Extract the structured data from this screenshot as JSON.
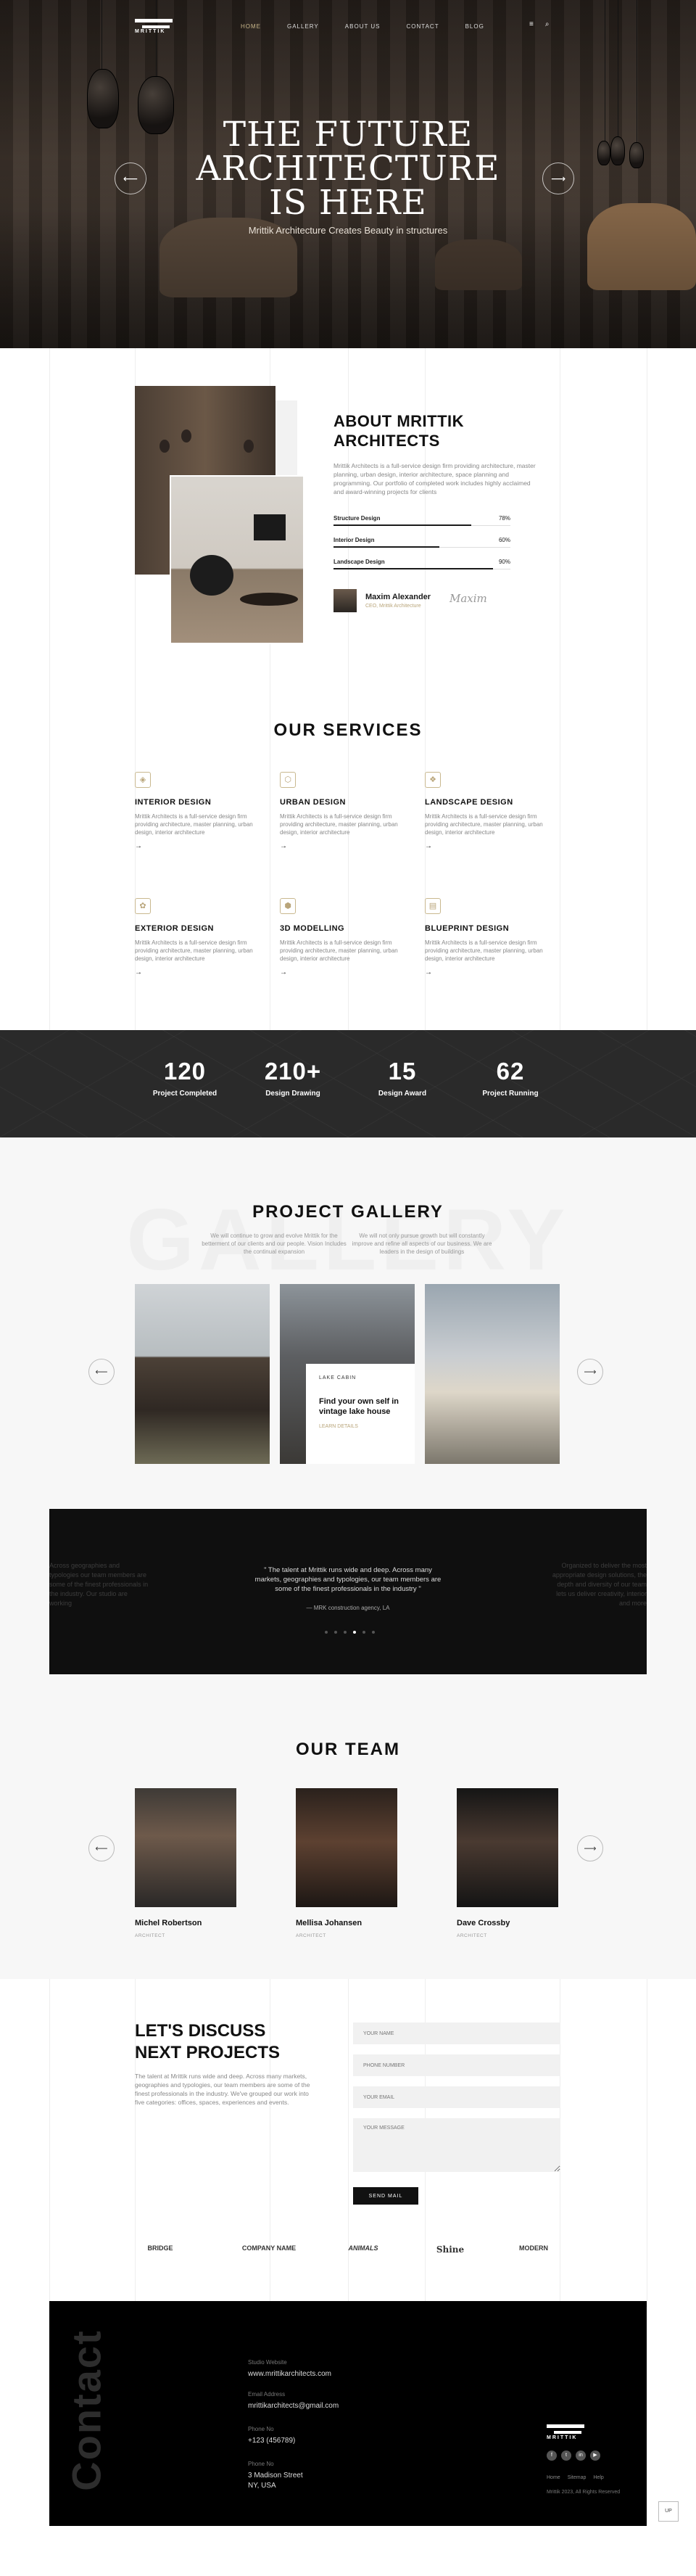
{
  "nav": {
    "logo_text": "MRITTIK",
    "items": [
      "HOME",
      "GALLERY",
      "ABOUT US",
      "CONTACT",
      "BLOG"
    ],
    "active_index": 0
  },
  "hero": {
    "title_lines": [
      "THE FUTURE",
      "ARCHITECTURE",
      "IS HERE"
    ],
    "subtitle": "Mrittik Architecture Creates Beauty in structures",
    "prev_icon": "arrow-left-icon",
    "next_icon": "arrow-right-icon"
  },
  "about": {
    "title_lines": [
      "ABOUT MRITTIK",
      "ARCHITECTS"
    ],
    "text": "Mrittik Architects is a full-service design firm providing architecture, master planning, urban design, interior architecture, space planning and programming. Our portfolio of completed work includes highly acclaimed and award-winning projects for clients",
    "skills": [
      {
        "label": "Structure Design",
        "percent": 78,
        "percent_text": "78%"
      },
      {
        "label": "Interior Design",
        "percent": 60,
        "percent_text": "60%"
      },
      {
        "label": "Landscape Design",
        "percent": 90,
        "percent_text": "90%"
      }
    ],
    "author": {
      "name": "Maxim Alexander",
      "role": "CEO, Mrittik Architecture",
      "signature": "Maxim"
    }
  },
  "services": {
    "title": "OUR SERVICES",
    "items": [
      {
        "title": "INTERIOR DESIGN",
        "desc": "Mrittik Architects is a full-service design firm providing architecture, master planning, urban design, interior architecture",
        "icon": "interior-icon"
      },
      {
        "title": "URBAN DESIGN",
        "desc": "Mrittik Architects is a full-service design firm providing architecture, master planning, urban design, interior architecture",
        "icon": "urban-icon"
      },
      {
        "title": "LANDSCAPE DESIGN",
        "desc": "Mrittik Architects is a full-service design firm providing architecture, master planning, urban design, interior architecture",
        "icon": "landscape-icon"
      },
      {
        "title": "EXTERIOR DESIGN",
        "desc": "Mrittik Architects is a full-service design firm providing architecture, master planning, urban design, interior architecture",
        "icon": "exterior-icon"
      },
      {
        "title": "3D MODELLING",
        "desc": "Mrittik Architects is a full-service design firm providing architecture, master planning, urban design, interior architecture",
        "icon": "cube-icon"
      },
      {
        "title": "BLUEPRINT DESIGN",
        "desc": "Mrittik Architects is a full-service design firm providing architecture, master planning, urban design, interior architecture",
        "icon": "blueprint-icon"
      }
    ],
    "arrow": "→"
  },
  "stats": [
    {
      "number": "120",
      "label": "Project Completed"
    },
    {
      "number": "210+",
      "label": "Design Drawing"
    },
    {
      "number": "15",
      "label": "Design Award"
    },
    {
      "number": "62",
      "label": "Project Running"
    }
  ],
  "gallery": {
    "title": "PROJECT GALLERY",
    "background_word": "GALLERY",
    "intro_left": "We will continue to grow and evolve Mrittik for the betterment of our clients and our people. Vision Includes the continual expansion",
    "intro_right": "We will not only pursue growth but will constantly improve and refine all aspects of our business. We are leaders in the design of buildings",
    "card": {
      "kicker": "LAKE CABIN",
      "title": "Find your own self in vintage lake house",
      "more": "LEARN DETAILS"
    }
  },
  "testimonial": {
    "quote": "\" The talent at Mrittik runs wide and deep. Across many markets, geographies and typologies, our team members are some of the finest professionals in the industry \"",
    "author": "— MRK construction agency, LA",
    "side_left": "Across geographies and typologies our team members are some of the finest professionals in the industry. Our studio are working",
    "side_right": "Organized to deliver the most appropriate design solutions, the depth and diversity of our team lets us deliver creativity, interior and more",
    "dots": 6,
    "active_dot": 3
  },
  "team": {
    "title": "OUR TEAM",
    "members": [
      {
        "name": "Michel Robertson",
        "role": "ARCHITECT"
      },
      {
        "name": "Mellisa Johansen",
        "role": "ARCHITECT"
      },
      {
        "name": "Dave Crossby",
        "role": "ARCHITECT"
      }
    ]
  },
  "contact_form": {
    "title_lines": [
      "LET'S DISCUSS",
      "NEXT PROJECTS"
    ],
    "text": "The talent at Mrittik runs wide and deep. Across many markets, geographies and typologies, our team members are some of the finest professionals in the industry. We've grouped our work into five categories: offices, spaces, experiences and events.",
    "placeholders": [
      "YOUR NAME",
      "PHONE NUMBER",
      "YOUR EMAIL",
      "YOUR MESSAGE"
    ],
    "submit": "SEND MAIL"
  },
  "brands": [
    "BRIDGE",
    "COMPANY NAME",
    "ANIMALS",
    "Shine",
    "MODERN"
  ],
  "footer": {
    "big_word": "Contact",
    "website_label": "Studio Website",
    "website": "www.mrittikarchitects.com",
    "email_label": "Email Address",
    "email": "mrittikarchitects@gmail.com",
    "phone_label": "Phone No",
    "phone": "+123 (456789)",
    "address_label": "Phone No",
    "address_lines": [
      "3 Madison Street",
      "NY, USA"
    ],
    "logo_text": "MRITTIK",
    "links": [
      "Home",
      "Sitemap",
      "Help"
    ],
    "copyright": "Mrittik 2023, All Rights Reserved",
    "socials": [
      "facebook-icon",
      "twitter-icon",
      "linkedin-icon",
      "youtube-icon"
    ],
    "top_label": "UP"
  }
}
